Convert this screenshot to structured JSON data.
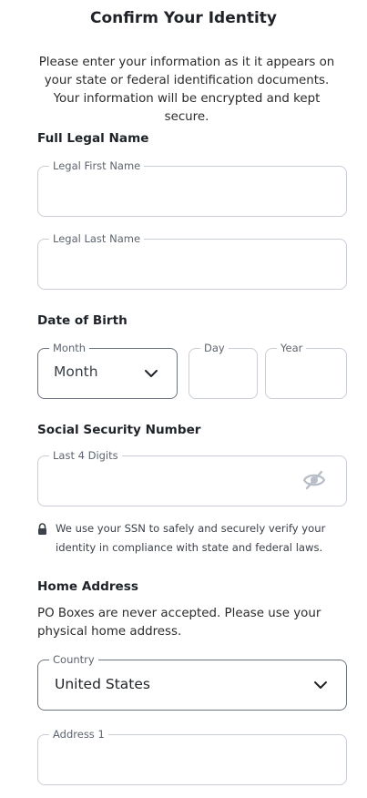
{
  "title": "Confirm Your Identity",
  "intro": "Please enter your information as it it appears on your state or federal identification documents. Your information will be encrypted and kept secure.",
  "sections": {
    "legal_name": "Full Legal Name",
    "dob": "Date of Birth",
    "ssn": "Social Security Number",
    "address": "Home Address"
  },
  "fields": {
    "first_name": {
      "label": "Legal First Name",
      "value": ""
    },
    "last_name": {
      "label": "Legal Last Name",
      "value": ""
    },
    "month": {
      "label": "Month",
      "value": "Month"
    },
    "day": {
      "label": "Day",
      "value": ""
    },
    "year": {
      "label": "Year",
      "value": ""
    },
    "ssn_last4": {
      "label": "Last 4 Digits",
      "value": ""
    },
    "country": {
      "label": "Country",
      "value": "United States"
    },
    "address1": {
      "label": "Address 1",
      "value": ""
    }
  },
  "ssn_note": "We use your SSN to safely and securely verify your identity in compliance with state and federal laws.",
  "address_note": "PO Boxes are never accepted. Please use your physical home address.",
  "icons": {
    "lock": "lock-icon",
    "eye": "eye-off-icon",
    "chevron": "chevron-down-icon"
  }
}
